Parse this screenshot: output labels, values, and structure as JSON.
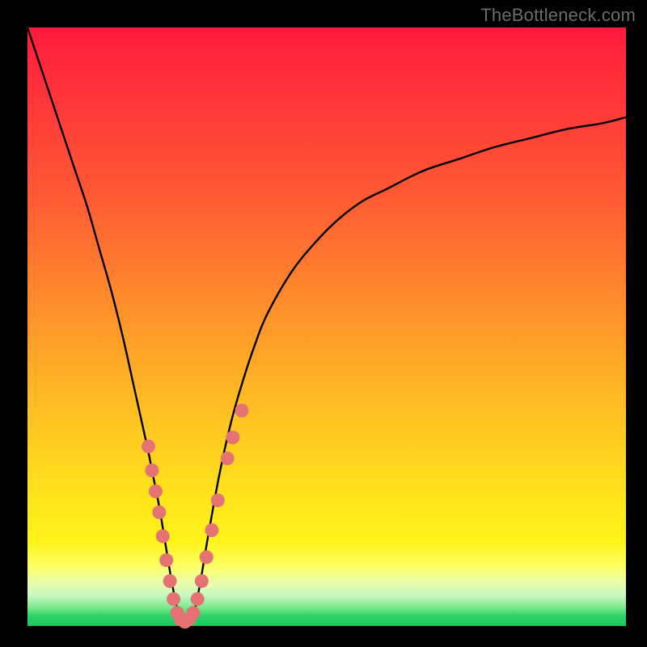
{
  "watermark": "TheBottleneck.com",
  "colors": {
    "frame": "#000000",
    "curve": "#000000",
    "dot_fill": "#e57373",
    "dot_stroke": "#d15a5a"
  },
  "chart_data": {
    "type": "line",
    "title": "",
    "xlabel": "",
    "ylabel": "",
    "xlim": [
      0,
      100
    ],
    "ylim": [
      0,
      100
    ],
    "series": [
      {
        "name": "bottleneck-curve",
        "x": [
          0,
          2,
          4,
          6,
          8,
          10,
          12,
          14,
          16,
          18,
          20,
          21,
          22,
          23,
          24,
          25,
          26,
          27,
          28,
          29,
          30,
          32,
          34,
          36,
          38,
          40,
          44,
          48,
          52,
          56,
          60,
          66,
          72,
          78,
          84,
          90,
          96,
          100
        ],
        "y": [
          100,
          94,
          88,
          82,
          76,
          70,
          63,
          56,
          48,
          39,
          30,
          25,
          20,
          14,
          8,
          3,
          1,
          1,
          3,
          8,
          14,
          25,
          34,
          41,
          47,
          52,
          59,
          64,
          68,
          71,
          73,
          76,
          78,
          80,
          81.5,
          83,
          84,
          85
        ]
      }
    ],
    "dots": {
      "name": "highlighted-points",
      "points": [
        {
          "x": 20.2,
          "y": 30
        },
        {
          "x": 20.8,
          "y": 26
        },
        {
          "x": 21.4,
          "y": 22.5
        },
        {
          "x": 22.0,
          "y": 19
        },
        {
          "x": 22.6,
          "y": 15
        },
        {
          "x": 23.2,
          "y": 11
        },
        {
          "x": 23.8,
          "y": 7.5
        },
        {
          "x": 24.4,
          "y": 4.5
        },
        {
          "x": 25.0,
          "y": 2.2
        },
        {
          "x": 25.6,
          "y": 1.1
        },
        {
          "x": 26.3,
          "y": 0.7
        },
        {
          "x": 27.0,
          "y": 1.1
        },
        {
          "x": 27.7,
          "y": 2.2
        },
        {
          "x": 28.4,
          "y": 4.5
        },
        {
          "x": 29.1,
          "y": 7.5
        },
        {
          "x": 29.9,
          "y": 11.5
        },
        {
          "x": 30.8,
          "y": 16
        },
        {
          "x": 31.8,
          "y": 21
        },
        {
          "x": 33.4,
          "y": 28
        },
        {
          "x": 34.3,
          "y": 31.5
        },
        {
          "x": 35.8,
          "y": 36
        }
      ]
    }
  }
}
